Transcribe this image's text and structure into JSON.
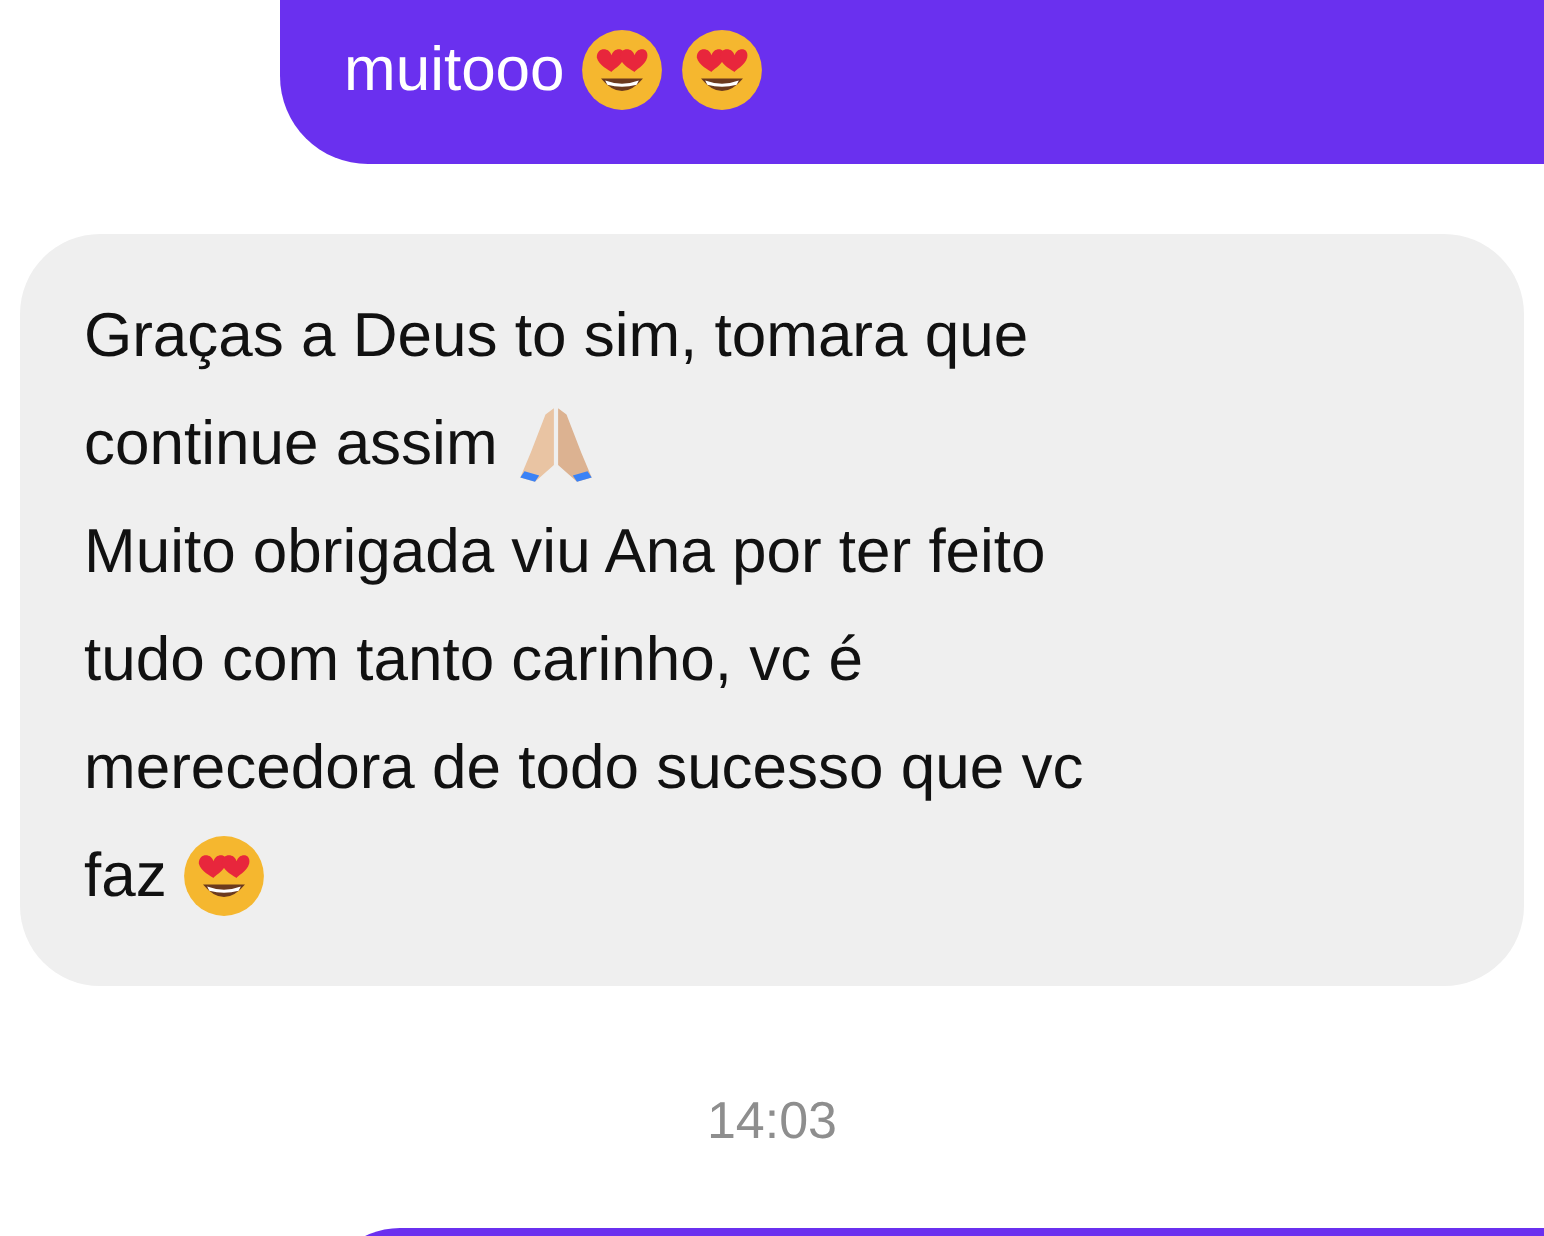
{
  "messages": [
    {
      "kind": "outgoing",
      "lines": [
        [
          {
            "kind": "text",
            "text": "muitooo"
          },
          {
            "kind": "heart-eyes"
          },
          {
            "kind": "heart-eyes"
          }
        ]
      ]
    },
    {
      "kind": "incoming",
      "lines": [
        [
          {
            "kind": "text",
            "text": "Graças a Deus to sim, tomara que"
          }
        ],
        [
          {
            "kind": "text",
            "text": "continue assim"
          },
          {
            "kind": "hands"
          }
        ],
        [
          {
            "kind": "text",
            "text": "Muito obrigada viu Ana por ter feito"
          }
        ],
        [
          {
            "kind": "text",
            "text": "tudo com tanto carinho, vc é"
          }
        ],
        [
          {
            "kind": "text",
            "text": "merecedora de todo sucesso que vc"
          }
        ],
        [
          {
            "kind": "text",
            "text": "faz"
          },
          {
            "kind": "heart-eyes"
          }
        ]
      ]
    },
    {
      "kind": "timestamp",
      "text": "14:03"
    },
    {
      "kind": "outgoing-cut"
    }
  ]
}
